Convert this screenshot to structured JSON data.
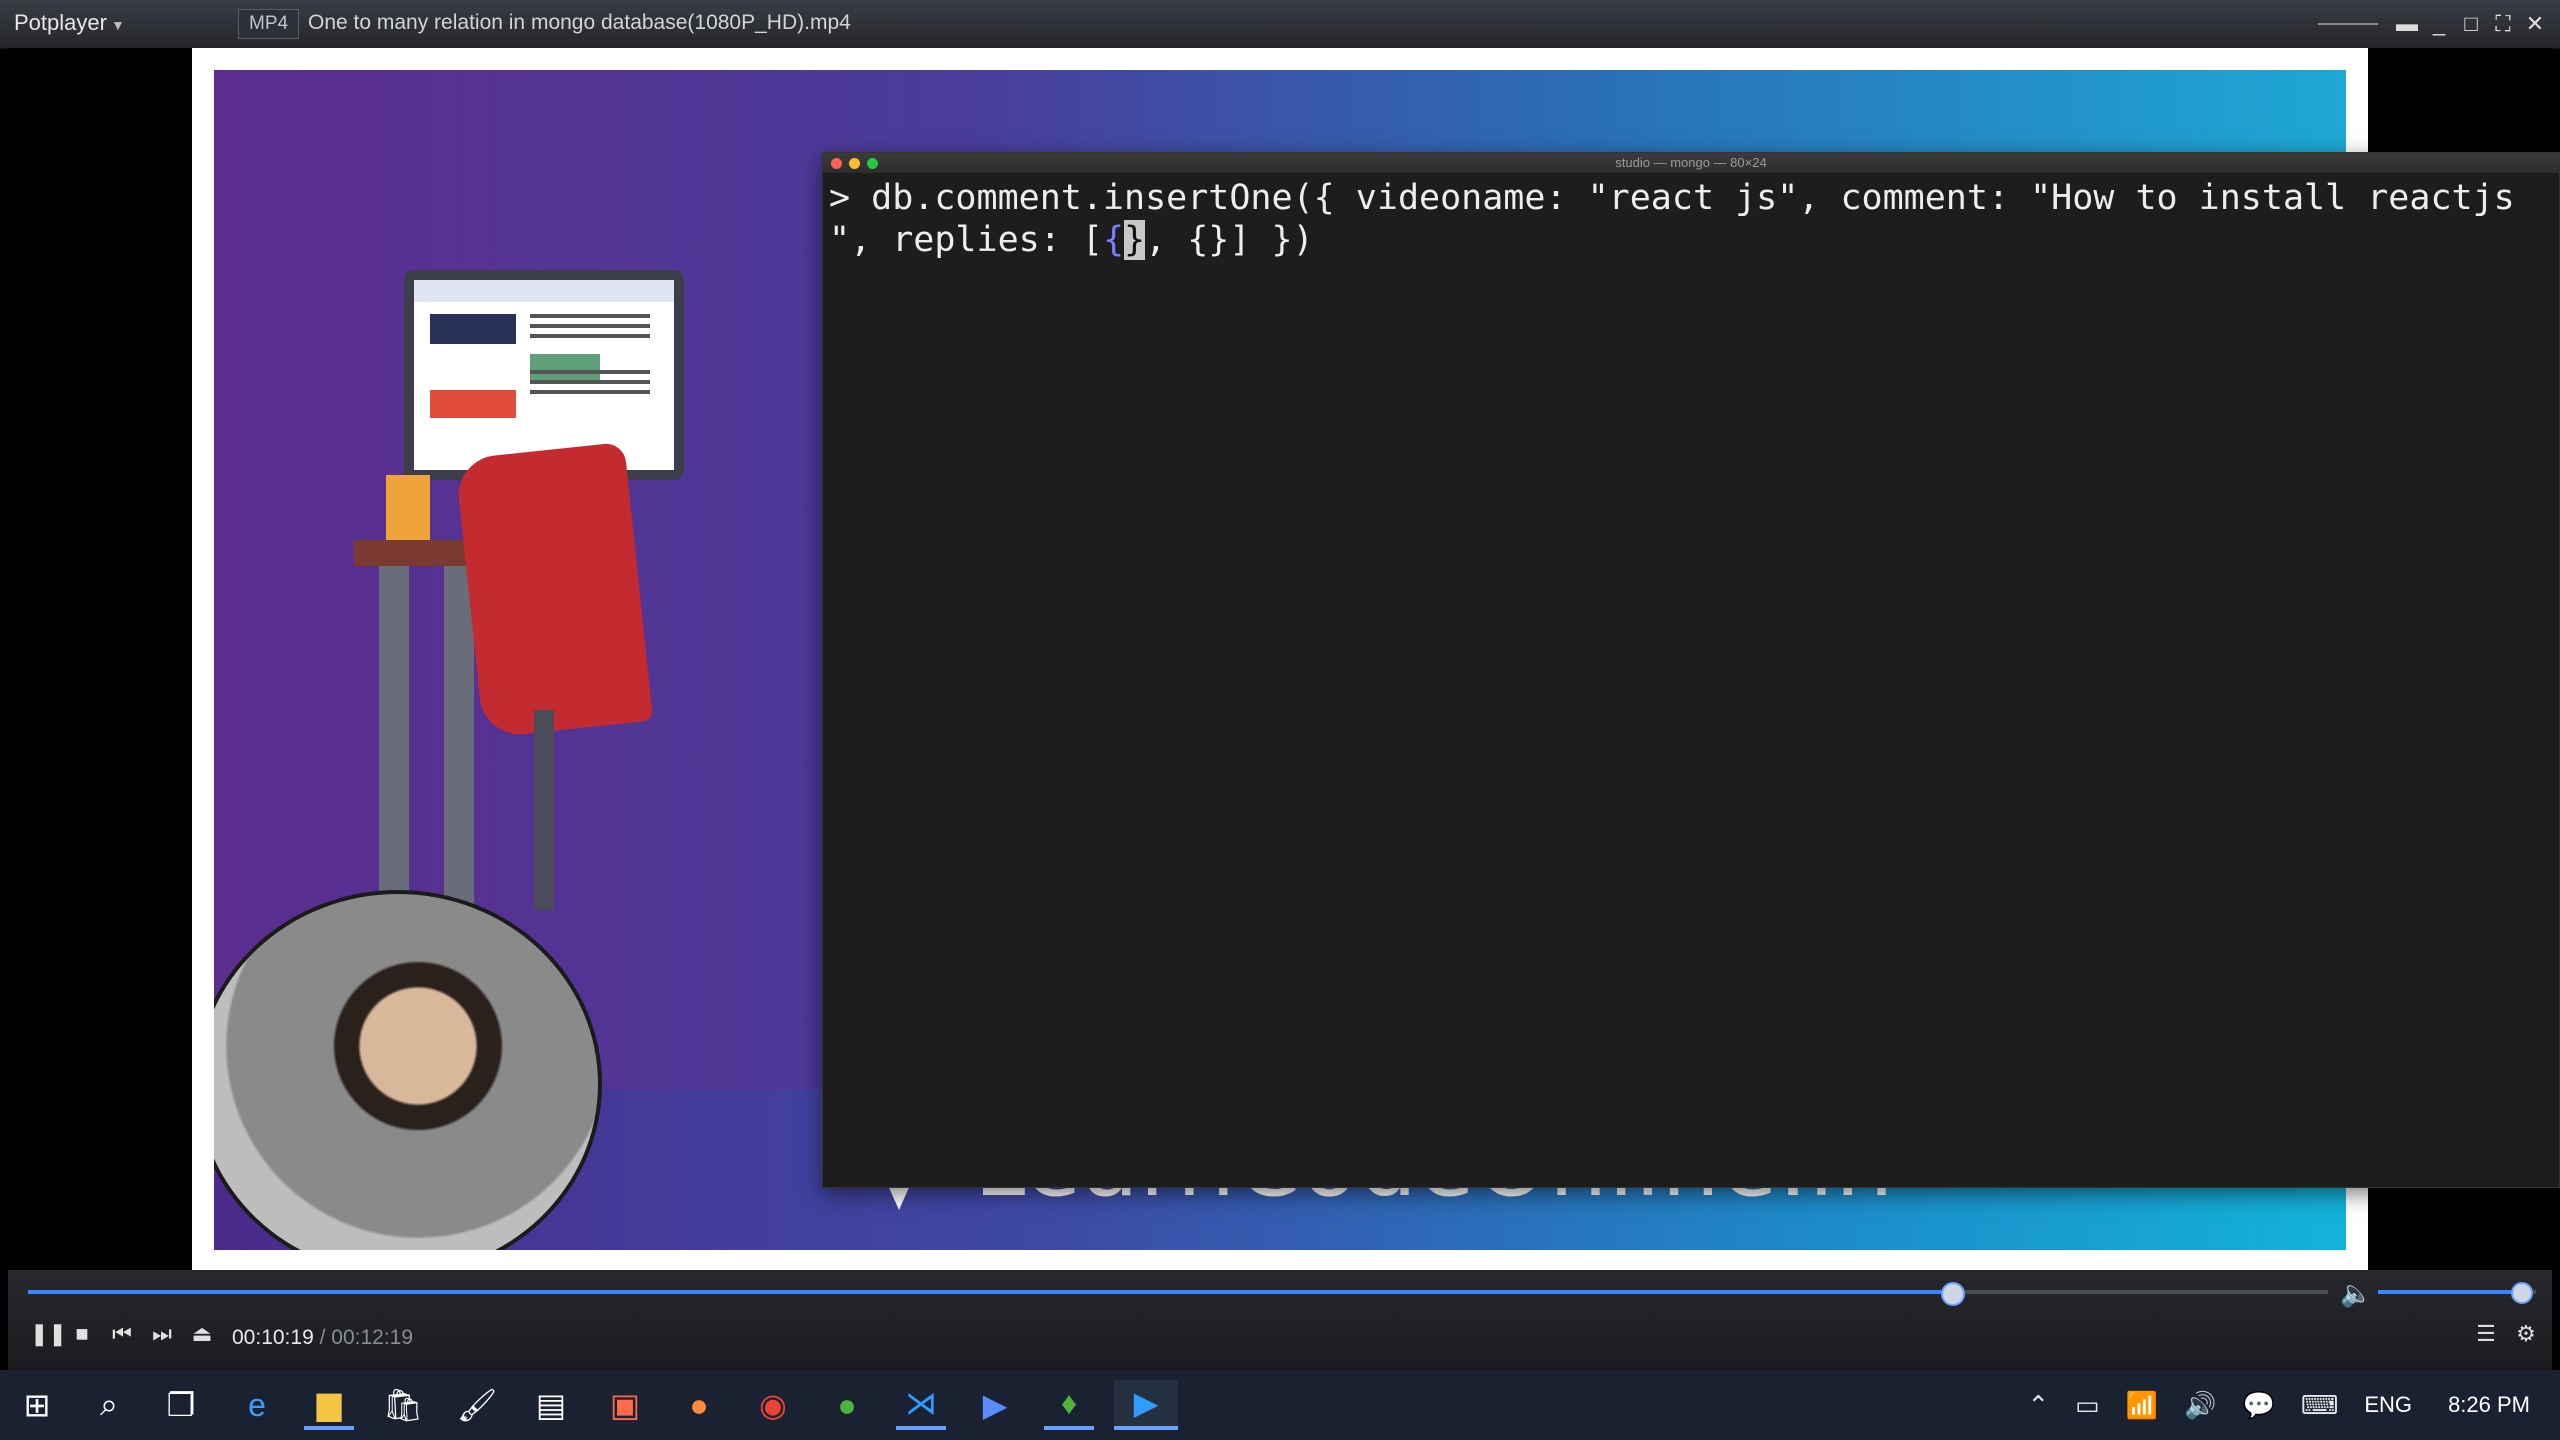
{
  "app": {
    "menu_label": "Potplayer",
    "format_badge": "MP4",
    "file_title": "One to many relation in mongo database(1080P_HD).mp4"
  },
  "video": {
    "terminal": {
      "title": "studio — mongo — 80×24",
      "line1": "> db.comment.insertOne({ videoname: \"react js\", comment: \"How to install reactjs",
      "line2_prefix": "\", replies: [",
      "line2_curly": "{",
      "line2_cursor": "}",
      "line2_suffix": ", {}] })"
    },
    "brand_text": "LearnCodeOnline.in"
  },
  "player": {
    "current_time": "00:10:19",
    "separator": " / ",
    "total_time": "00:12:19",
    "progress_fraction": 0.8362,
    "volume_fraction": 0.9
  },
  "taskbar": {
    "language": "ENG",
    "clock": "8:26 PM"
  },
  "colors": {
    "accent": "#3a86ff",
    "terminal_bg": "#1d1d1d",
    "taskbar_bg": "#1a2130"
  }
}
